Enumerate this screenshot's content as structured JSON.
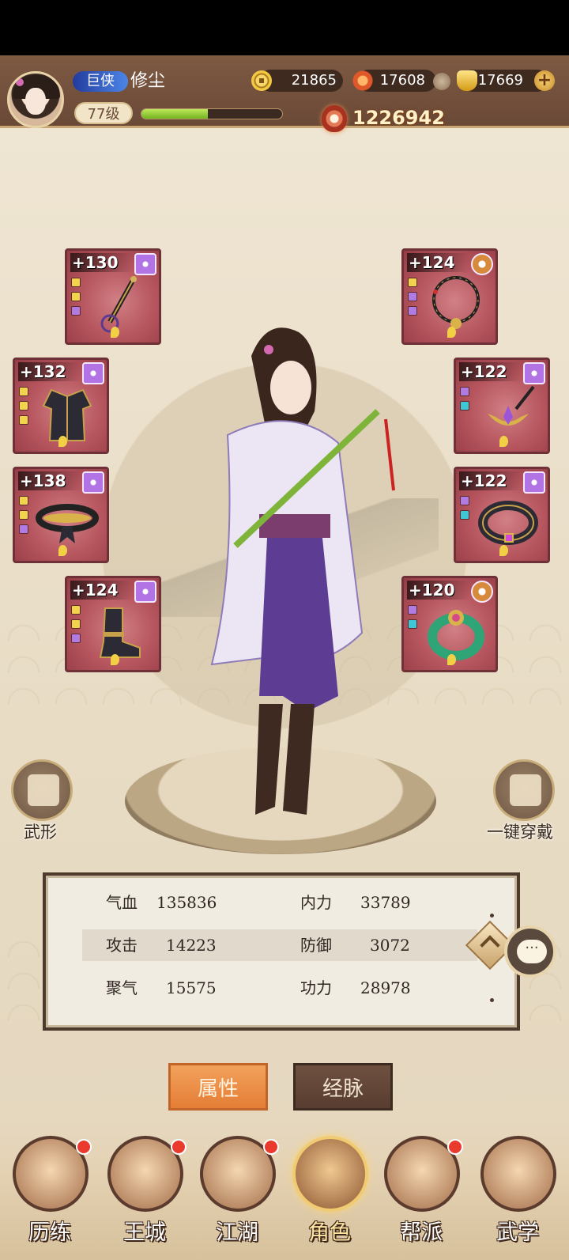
{
  "header": {
    "title_badge": "巨侠",
    "player_name": "修尘",
    "level": "77级",
    "xp_progress": 0.47,
    "currencies": [
      {
        "icon": "copper-coin-icon",
        "value": "21865"
      },
      {
        "icon": "flame-leaf-icon",
        "value": "17608"
      },
      {
        "icon": "gold-ingot-icon",
        "value": "17669"
      }
    ],
    "power": "1226942"
  },
  "equipment": {
    "left": [
      {
        "level": "+130",
        "grade": "purple",
        "item": "whip-weapon-icon",
        "gems": [
          "y",
          "y",
          "p"
        ]
      },
      {
        "level": "+132",
        "grade": "purple",
        "item": "robe-armor-icon",
        "gems": [
          "y",
          "y",
          "y"
        ]
      },
      {
        "level": "+138",
        "grade": "purple",
        "item": "belt-icon",
        "gems": [
          "y",
          "y",
          "p"
        ]
      },
      {
        "level": "+124",
        "grade": "purple",
        "item": "boots-icon",
        "gems": [
          "y",
          "y",
          "p"
        ]
      }
    ],
    "right": [
      {
        "level": "+124",
        "grade": "gold",
        "item": "necklace-icon",
        "gems": [
          "y",
          "p",
          "p"
        ]
      },
      {
        "level": "+122",
        "grade": "purple",
        "item": "hair-ornament-icon",
        "gems": [
          "p",
          "c"
        ]
      },
      {
        "level": "+122",
        "grade": "purple",
        "item": "bracelet-icon",
        "gems": [
          "p",
          "c"
        ]
      },
      {
        "level": "+120",
        "grade": "gold",
        "item": "jade-ring-icon",
        "gems": [
          "p",
          "c"
        ]
      }
    ]
  },
  "side_buttons": {
    "left_label": "武形",
    "right_label": "一键穿戴"
  },
  "stats": [
    {
      "name": "气血",
      "value": "135836"
    },
    {
      "name": "内力",
      "value": "33789"
    },
    {
      "name": "攻击",
      "value": "14223"
    },
    {
      "name": "防御",
      "value": "3072"
    },
    {
      "name": "聚气",
      "value": "15575"
    },
    {
      "name": "功力",
      "value": "28978"
    }
  ],
  "chat_glyph": "···",
  "tabs": {
    "attributes": "属性",
    "meridians": "经脉"
  },
  "nav": [
    {
      "label": "历练",
      "badge": true
    },
    {
      "label": "王城",
      "badge": true
    },
    {
      "label": "江湖",
      "badge": true
    },
    {
      "label": "角色",
      "badge": false,
      "active": true
    },
    {
      "label": "帮派",
      "badge": true
    },
    {
      "label": "武学",
      "badge": false
    }
  ]
}
